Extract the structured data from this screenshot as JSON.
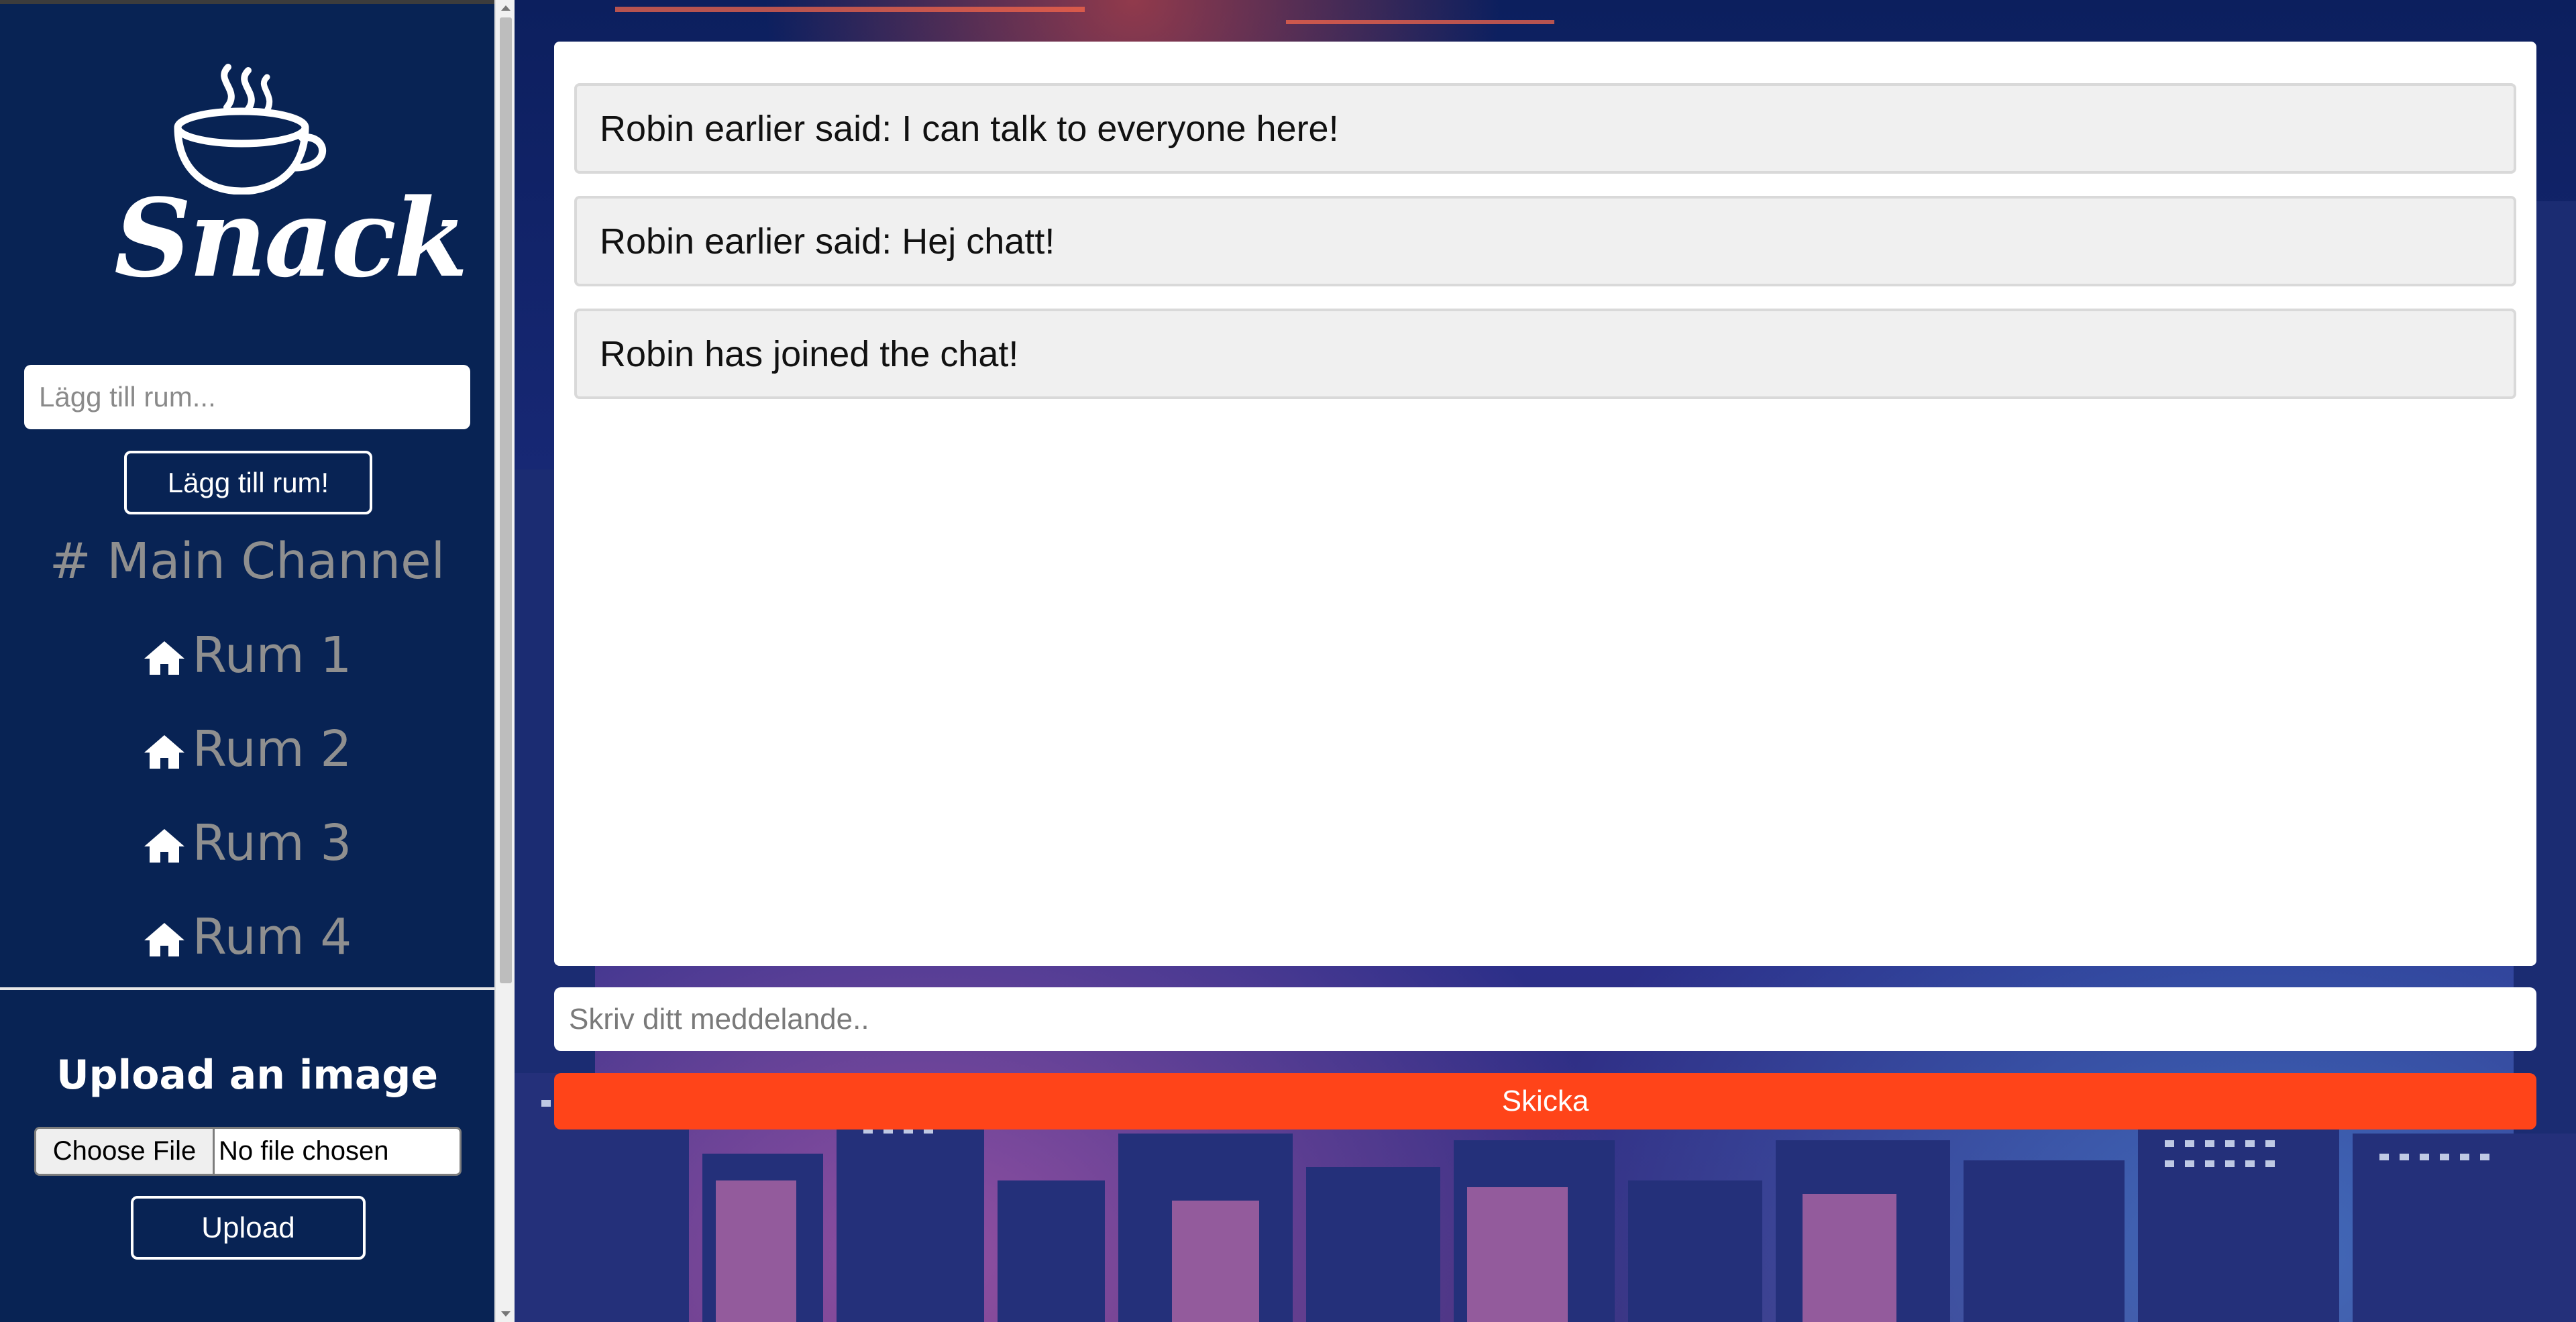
{
  "app": {
    "name": "Snack"
  },
  "sidebar": {
    "room_input_placeholder": "Lägg till rum...",
    "add_room_label": "Lägg till rum!",
    "channels": [
      {
        "label": "# Main Channel",
        "icon": ""
      },
      {
        "label": "Rum 1",
        "icon": "home-icon"
      },
      {
        "label": "Rum 2",
        "icon": "home-icon"
      },
      {
        "label": "Rum 3",
        "icon": "home-icon"
      },
      {
        "label": "Rum 4",
        "icon": "home-icon"
      }
    ],
    "upload": {
      "title": "Upload an image",
      "choose_file_label": "Choose File",
      "file_status": "No file chosen",
      "upload_label": "Upload"
    }
  },
  "chat": {
    "messages": [
      "Robin earlier said: I can talk to everyone here!",
      "Robin earlier said: Hej chatt!",
      "Robin has joined the chat!"
    ],
    "input_placeholder": "Skriv ditt meddelande..",
    "send_label": "Skicka"
  },
  "colors": {
    "sidebar_bg": "#082354",
    "send_button": "#ff4419",
    "channel_text": "#8f8f8f"
  }
}
